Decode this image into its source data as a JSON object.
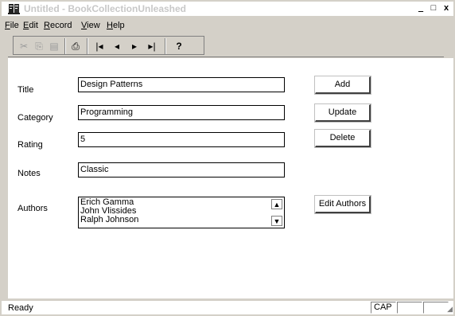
{
  "window": {
    "title": "Untitled - BookCollectionUnleashed",
    "controls": {
      "minimize": "_",
      "maximize": "□",
      "close": "x"
    }
  },
  "menu": {
    "items": [
      {
        "label": "File",
        "accel": "F",
        "rest": "ile"
      },
      {
        "label": "Edit",
        "accel": "E",
        "rest": "dit"
      },
      {
        "label": "Record",
        "accel": "R",
        "rest": "ecord"
      },
      {
        "label": "View",
        "accel": "V",
        "rest": "iew"
      },
      {
        "label": "Help",
        "accel": "H",
        "rest": "elp"
      }
    ]
  },
  "toolbar": {
    "buttons": [
      {
        "name": "cut-icon",
        "glyph": "✂",
        "enabled": false
      },
      {
        "name": "copy-icon",
        "glyph": "⎘",
        "enabled": false
      },
      {
        "name": "paste-icon",
        "glyph": "▤",
        "enabled": false
      },
      {
        "name": "print-icon",
        "glyph": "⎙",
        "enabled": true
      },
      {
        "name": "first-record-icon",
        "glyph": "|◂",
        "enabled": true
      },
      {
        "name": "previous-record-icon",
        "glyph": "◂",
        "enabled": true
      },
      {
        "name": "next-record-icon",
        "glyph": "▸",
        "enabled": true
      },
      {
        "name": "last-record-icon",
        "glyph": "▸|",
        "enabled": true
      },
      {
        "name": "help-icon",
        "glyph": "?",
        "enabled": true
      }
    ]
  },
  "form": {
    "title_label": "Title",
    "title_value": "Design Patterns",
    "category_label": "Category",
    "category_value": "Programming",
    "rating_label": "Rating",
    "rating_value": "5",
    "notes_label": "Notes",
    "notes_value": "Classic",
    "authors_label": "Authors",
    "authors": [
      "Erich Gamma",
      "John Vlissides",
      "Ralph Johnson"
    ]
  },
  "buttons": {
    "add": "Add",
    "update": "Update",
    "delete": "Delete",
    "edit_authors": "Edit Authors"
  },
  "status": {
    "text": "Ready",
    "cap": "CAP"
  }
}
